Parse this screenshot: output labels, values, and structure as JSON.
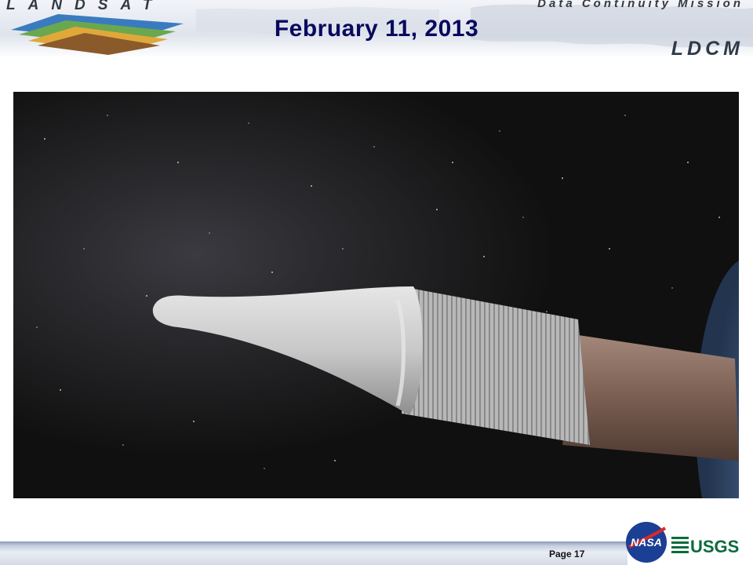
{
  "header": {
    "brand_left": "LANDSAT",
    "brand_right": "Data Continuity Mission",
    "mission_abbrev": "LDCM",
    "title": "February 11, 2013"
  },
  "image": {
    "icon": "rocket-fairing-in-space"
  },
  "footer": {
    "page": "Page 17",
    "agency_logos": {
      "nasa_text": "NASA",
      "usgs_text": "USGS"
    }
  },
  "colors": {
    "title": "#08095e",
    "usgs_green": "#0a6b3b",
    "nasa_blue": "#1b3f95",
    "nasa_red": "#d62a2a"
  }
}
